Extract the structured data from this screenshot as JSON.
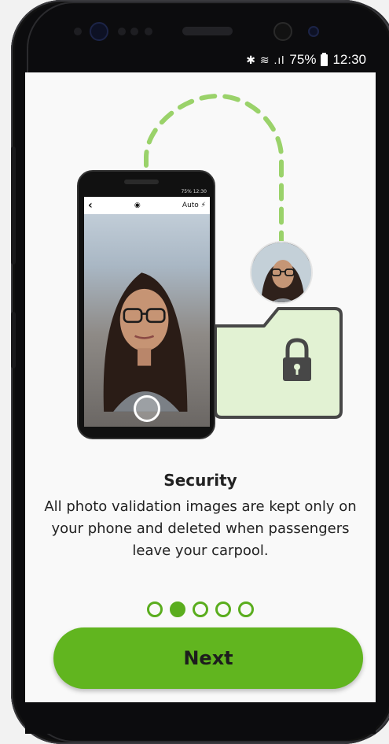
{
  "status_bar": {
    "icons": "✱ ≋ .ıl",
    "battery": "75%",
    "time": "12:30"
  },
  "illustration": {
    "phone_status": "75% 12:30",
    "flash_label": "Auto ⚡",
    "back_glyph": "‹",
    "camera_glyph": "◉",
    "icons": [
      "phone-illustration",
      "shutter-button-icon",
      "lock-icon",
      "folder-icon",
      "avatar-icon",
      "dashed-connector-icon"
    ],
    "colors": {
      "dash": "#9ad26a",
      "folder_fill": "#e2f2d3",
      "folder_stroke": "#474747"
    }
  },
  "onboarding": {
    "title": "Security",
    "description": "All photo validation images are kept only on your phone and deleted when passengers leave your carpool.",
    "page_count": 5,
    "active_index": 1
  },
  "actions": {
    "next_label": "Next"
  },
  "colors": {
    "accent": "#61b51f",
    "dot": "#5aad1e"
  }
}
